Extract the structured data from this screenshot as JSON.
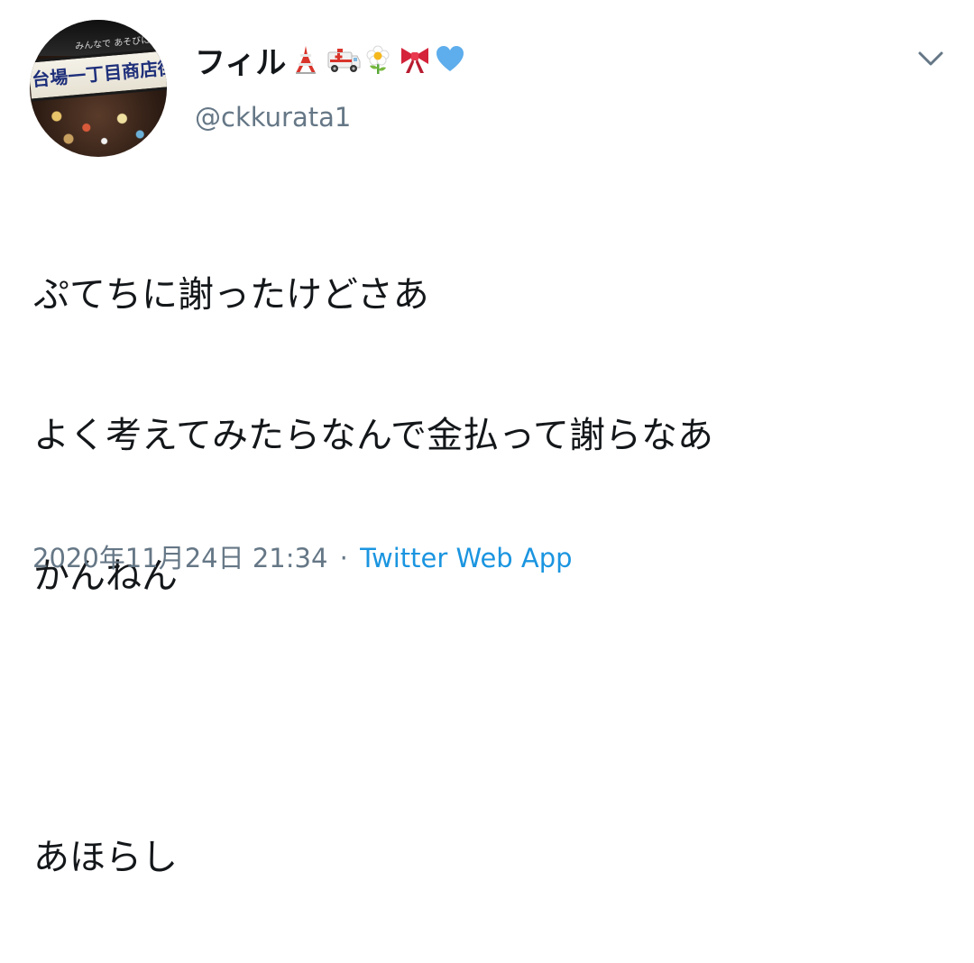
{
  "tweet": {
    "display_name": "フィル",
    "name_emojis": [
      "tokyo-tower-emoji",
      "ambulance-emoji",
      "blossom-emoji",
      "ribbon-emoji",
      "blue-heart-emoji"
    ],
    "handle": "@ckkurata1",
    "text_lines": [
      "ぷてちに謝ったけどさあ",
      "よく考えてみたらなんで金払って謝らなあ",
      "かんねん",
      "",
      "あほらし"
    ],
    "timestamp": "2020年11月24日 21:34",
    "separator": "·",
    "source": "Twitter Web App"
  },
  "avatar": {
    "sign_text": "台場一丁目商店街",
    "top_text": "みんなで あそびに"
  },
  "colors": {
    "text": "#14171a",
    "secondary": "#657786",
    "link": "#1b95e0",
    "chevron": "#657786"
  }
}
